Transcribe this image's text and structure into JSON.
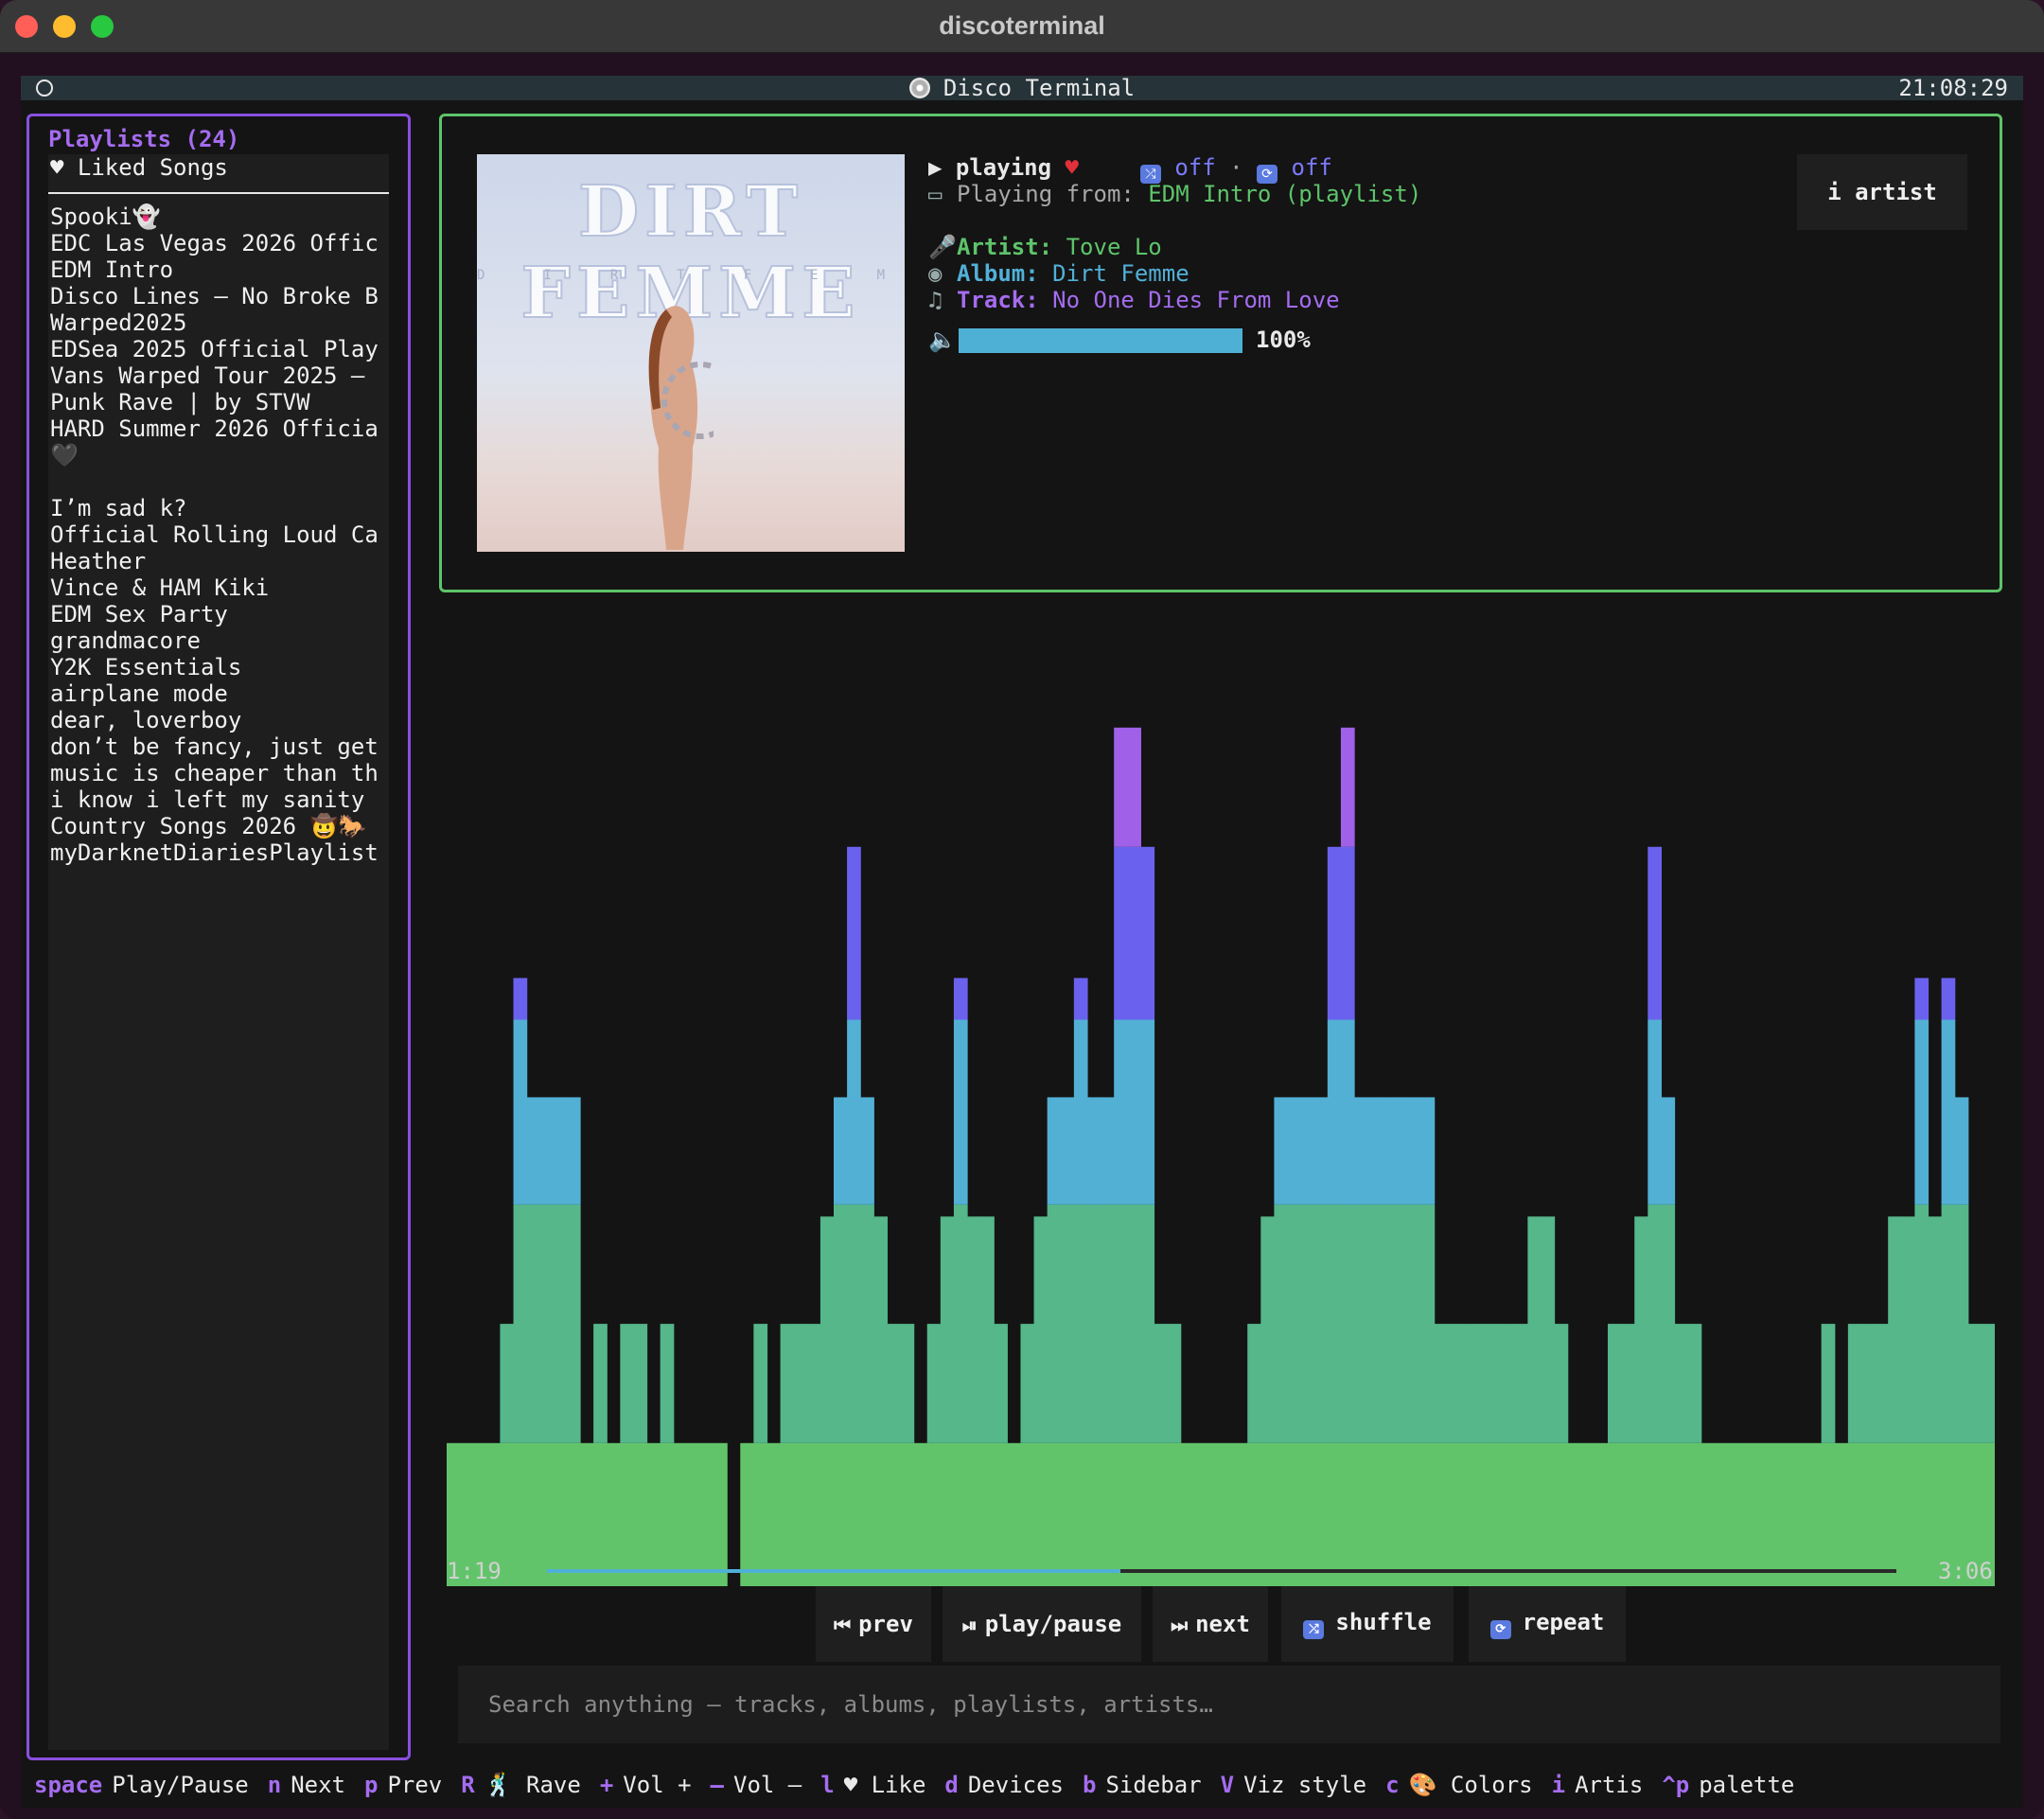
{
  "window": {
    "title": "discoterminal"
  },
  "topbar": {
    "title": "Disco Terminal",
    "clock": "21:08:29"
  },
  "sidebar": {
    "heading": "Playlists (24)",
    "liked": "♥ Liked Songs",
    "items": [
      "Spooki👻",
      "EDC Las Vegas 2026 Offic",
      "EDM Intro",
      "Disco Lines – No Broke B",
      "Warped2025",
      "EDSea 2025 Official Play",
      "Vans Warped Tour 2025 –",
      "Punk Rave | by STVW",
      "HARD Summer 2026 Officia",
      "🖤",
      "",
      "I’m sad k?",
      "Official Rolling Loud Ca",
      "Heather",
      "Vince & HAM Kiki",
      "EDM Sex Party",
      "grandmacore",
      "Y2K Essentials",
      "airplane mode",
      "dear, loverboy",
      "don’t be fancy, just get",
      "music is cheaper than th",
      "i know i left my sanity",
      "Country Songs 2026  🤠🐎",
      "myDarknetDiariesPlaylist"
    ]
  },
  "now_playing": {
    "state": "playing",
    "shuffle_state": "off",
    "repeat_state": "off",
    "separator": "·",
    "from_label": "Playing from:",
    "from_value": "EDM Intro (playlist)",
    "artist_label": "Artist:",
    "artist": "Tove Lo",
    "album_label": "Album:",
    "album": "Dirt Femme",
    "track_label": "Track:",
    "track": "No One Dies From Love",
    "volume_pct": 100,
    "volume_text": "100%",
    "artist_button": "i artist",
    "cover_title": "DIRT FEMME",
    "cover_sub": "DIRTFEMME"
  },
  "visualizer": {
    "max_level": 6,
    "levels": [
      2,
      2,
      2,
      2,
      2,
      2,
      2,
      2,
      2,
      2,
      2,
      2,
      2,
      2,
      2,
      2,
      2,
      2,
      2,
      2,
      2,
      2,
      2,
      2,
      2,
      2,
      2,
      2,
      2,
      2,
      2,
      2,
      2,
      2,
      2,
      2,
      2,
      2,
      2,
      2,
      2,
      2,
      2,
      2,
      2,
      2,
      2,
      2,
      2,
      2,
      2,
      2,
      2,
      2,
      2,
      2,
      2,
      2,
      2,
      2,
      2,
      2,
      2,
      2,
      2,
      2,
      2,
      2,
      2,
      2,
      2,
      2,
      2,
      2,
      2,
      2,
      2,
      2,
      2,
      2,
      2,
      2,
      2,
      2,
      2,
      2,
      2,
      2,
      2,
      2,
      2,
      2,
      2,
      2,
      2,
      2,
      2,
      2,
      2,
      2,
      2,
      2,
      2,
      2,
      2,
      2,
      2,
      2,
      2,
      2
    ],
    "heights": [
      1.2,
      1.2,
      1.2,
      1.2,
      2.2,
      5.1,
      4.1,
      4.1,
      4.1,
      4.1,
      1.2,
      2.2,
      1.2,
      2.2,
      2.2,
      1.2,
      2.2,
      1.2,
      1.2,
      1.2,
      1.2,
      0,
      1.2,
      2.2,
      1.2,
      2.2,
      2.2,
      2.2,
      3.1,
      4.1,
      6.2,
      4.1,
      3.1,
      2.2,
      2.2,
      1.2,
      2.2,
      3.1,
      5.1,
      3.1,
      3.1,
      2.2,
      1.2,
      2.2,
      3.1,
      4.1,
      4.1,
      5.1,
      4.1,
      4.1,
      7.2,
      7.2,
      6.2,
      2.2,
      2.2,
      1.2,
      1.2,
      1.2,
      1.2,
      1.2,
      2.2,
      3.1,
      4.1,
      4.1,
      4.1,
      4.1,
      6.2,
      7.2,
      4.1,
      4.1,
      4.1,
      4.1,
      4.1,
      4.1,
      2.2,
      2.2,
      2.2,
      2.2,
      2.2,
      2.2,
      2.2,
      3.1,
      3.1,
      2.2,
      1.2,
      1.2,
      1.2,
      2.2,
      2.2,
      3.1,
      6.2,
      4.1,
      2.2,
      2.2,
      1.2,
      1.2,
      1.2,
      1.2,
      1.2,
      1.2,
      1.2,
      1.2,
      1.2,
      2.2,
      1.2,
      2.2,
      2.2,
      2.2,
      3.1,
      3.1,
      5.1,
      3.1,
      5.1,
      4.1,
      2.2,
      2.2
    ]
  },
  "progress": {
    "current": "1:19",
    "total": "3:06",
    "fraction": 0.425
  },
  "controls": {
    "prev": "prev",
    "play_pause": "play/pause",
    "next": "next",
    "shuffle": "shuffle",
    "repeat": "repeat"
  },
  "search": {
    "placeholder": "Search anything — tracks, albums, playlists, artists…"
  },
  "hints": [
    {
      "key": "space",
      "desc": "Play/Pause"
    },
    {
      "key": "n",
      "desc": "Next"
    },
    {
      "key": "p",
      "desc": "Prev"
    },
    {
      "key": "R",
      "desc": "🕺 Rave"
    },
    {
      "key": "+",
      "desc": "Vol +"
    },
    {
      "key": "–",
      "desc": "Vol –"
    },
    {
      "key": "l",
      "desc": "♥ Like"
    },
    {
      "key": "d",
      "desc": "Devices"
    },
    {
      "key": "b",
      "desc": "Sidebar"
    },
    {
      "key": "V",
      "desc": "Viz style"
    },
    {
      "key": "c",
      "desc": "🎨 Colors"
    },
    {
      "key": "i",
      "desc": "Artis"
    },
    {
      "key": "^p",
      "desc": "palette"
    }
  ],
  "colors": {
    "green": "#62c46a",
    "teal": "#55b78a",
    "cyan": "#52b0d4",
    "blue": "#6a62ee",
    "purple": "#a060e8",
    "accent": "#a56cf0"
  }
}
